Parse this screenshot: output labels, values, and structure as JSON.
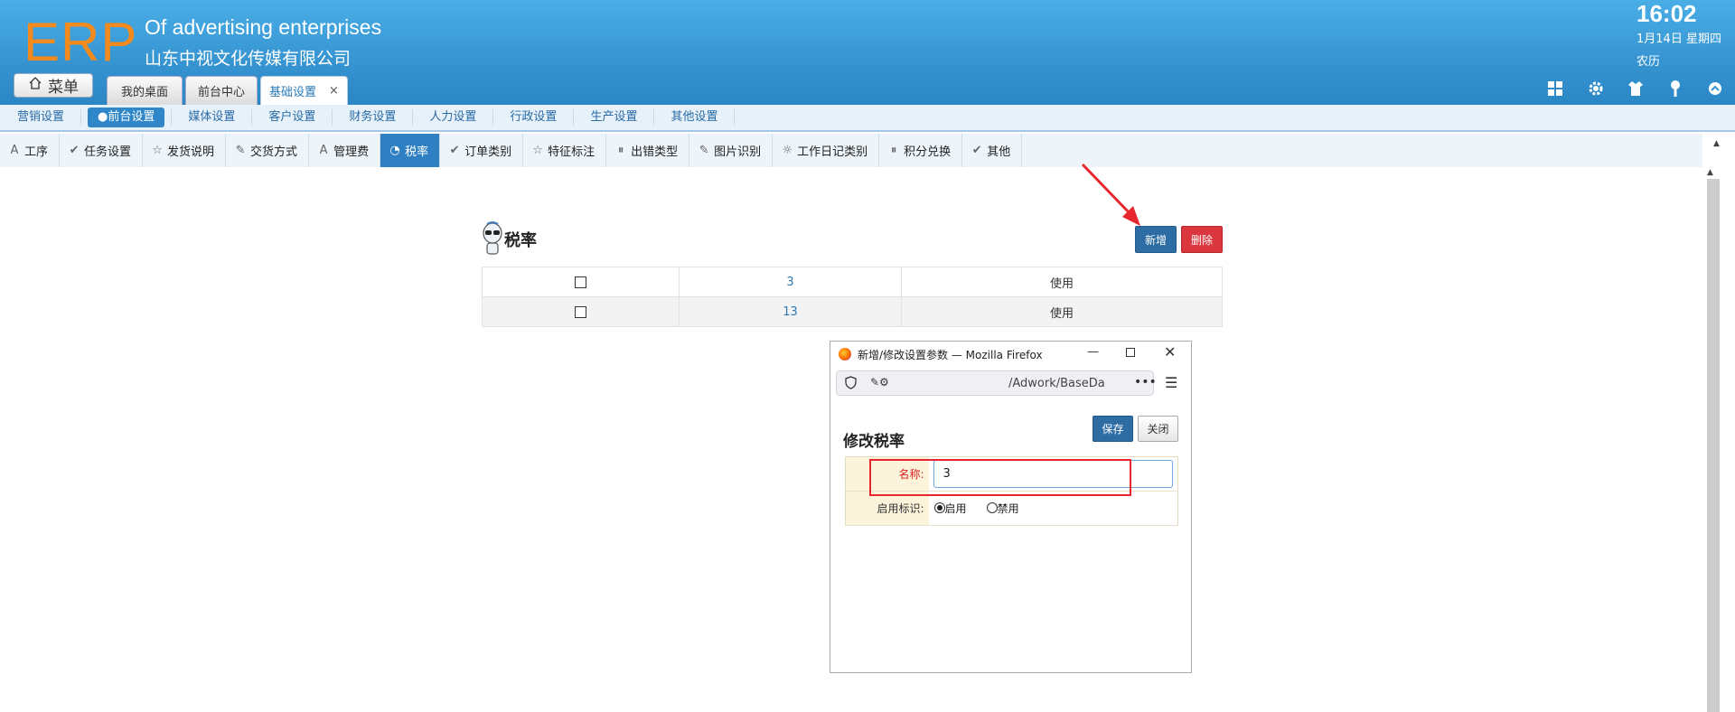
{
  "header": {
    "logo": "ERP",
    "subtitle_en": "Of advertising enterprises",
    "subtitle_cn": "山东中视文化传媒有限公司",
    "clock": "16:02",
    "date": "1月14日 星期四",
    "lunar": "农历",
    "icons": [
      "grid-icon",
      "gear-icon",
      "shirt-icon",
      "key-icon",
      "collapse-icon"
    ]
  },
  "menu_button": {
    "label": "菜单",
    "icon": "home-icon"
  },
  "main_tabs": [
    {
      "label": "我的桌面"
    },
    {
      "label": "前台中心"
    },
    {
      "label": "基础设置",
      "close": "×",
      "active": true
    }
  ],
  "sub_nav": {
    "items": [
      "营销设置",
      "●前台设置",
      "媒体设置",
      "客户设置",
      "财务设置",
      "人力设置",
      "行政设置",
      "生产设置",
      "其他设置"
    ],
    "active": "●前台设置"
  },
  "tool_tabs": [
    {
      "label": "工序",
      "icon": "A"
    },
    {
      "label": "任务设置",
      "icon": "✔"
    },
    {
      "label": "发货说明",
      "icon": "☆"
    },
    {
      "label": "交货方式",
      "icon": "✎"
    },
    {
      "label": "管理费",
      "icon": "A"
    },
    {
      "label": "税率",
      "icon": "◔",
      "active": true
    },
    {
      "label": "订单类别",
      "icon": "✔"
    },
    {
      "label": "特征标注",
      "icon": "☆"
    },
    {
      "label": "出错类型",
      "icon": "⏸"
    },
    {
      "label": "图片识别",
      "icon": "✎"
    },
    {
      "label": "工作日记类别",
      "icon": "☼"
    },
    {
      "label": "积分兑换",
      "icon": "⏸"
    },
    {
      "label": "其他",
      "icon": "✔"
    }
  ],
  "content": {
    "title": "税率",
    "add_label": "新增",
    "delete_label": "删除",
    "rows": [
      {
        "value": "3",
        "status": "使用"
      },
      {
        "value": "13",
        "status": "使用"
      }
    ]
  },
  "popup": {
    "window_title": "新增/修改设置参数 — Mozilla Firefox",
    "url": "/Adwork/BaseDa",
    "form_title": "修改税率",
    "save_label": "保存",
    "close_label": "关闭",
    "name_label": "名称:",
    "name_value": "3",
    "flag_label": "启用标识:",
    "radio_enabled": "启用",
    "radio_disabled": "禁用",
    "selected": "启用"
  },
  "colors": {
    "header_blue": "#3694d1",
    "logo_orange": "#f28a1e",
    "active_tab_blue": "#2e80c3",
    "add_blue": "#2e6da4",
    "delete_red": "#d9363e",
    "annotation_red": "#e8262d"
  }
}
